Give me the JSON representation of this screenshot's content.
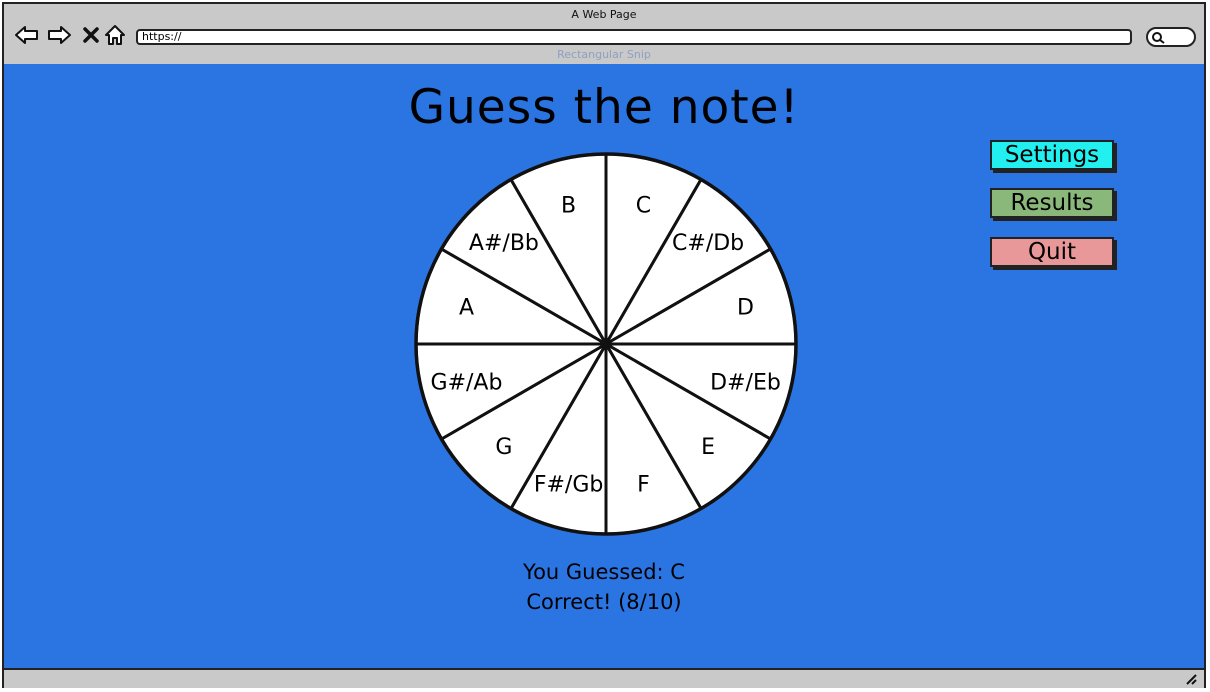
{
  "browser": {
    "title": "A Web Page",
    "url": "https://",
    "ghost_label": "Rectangular Snip"
  },
  "page": {
    "heading": "Guess the note!",
    "buttons": {
      "settings": {
        "label": "Settings",
        "color": "#22f0f0"
      },
      "results": {
        "label": "Results",
        "color": "#8ab87a"
      },
      "quit": {
        "label": "Quit",
        "color": "#e89898"
      }
    },
    "notes": [
      "C",
      "C#/Db",
      "D",
      "D#/Eb",
      "E",
      "F",
      "F#/Gb",
      "G",
      "G#/Ab",
      "A",
      "A#/Bb",
      "B"
    ],
    "status": {
      "guess": "You Guessed:  C",
      "result": "Correct! (8/10)"
    }
  },
  "colors": {
    "page_background": "#2b75e3",
    "chrome": "#c9c9c9"
  }
}
